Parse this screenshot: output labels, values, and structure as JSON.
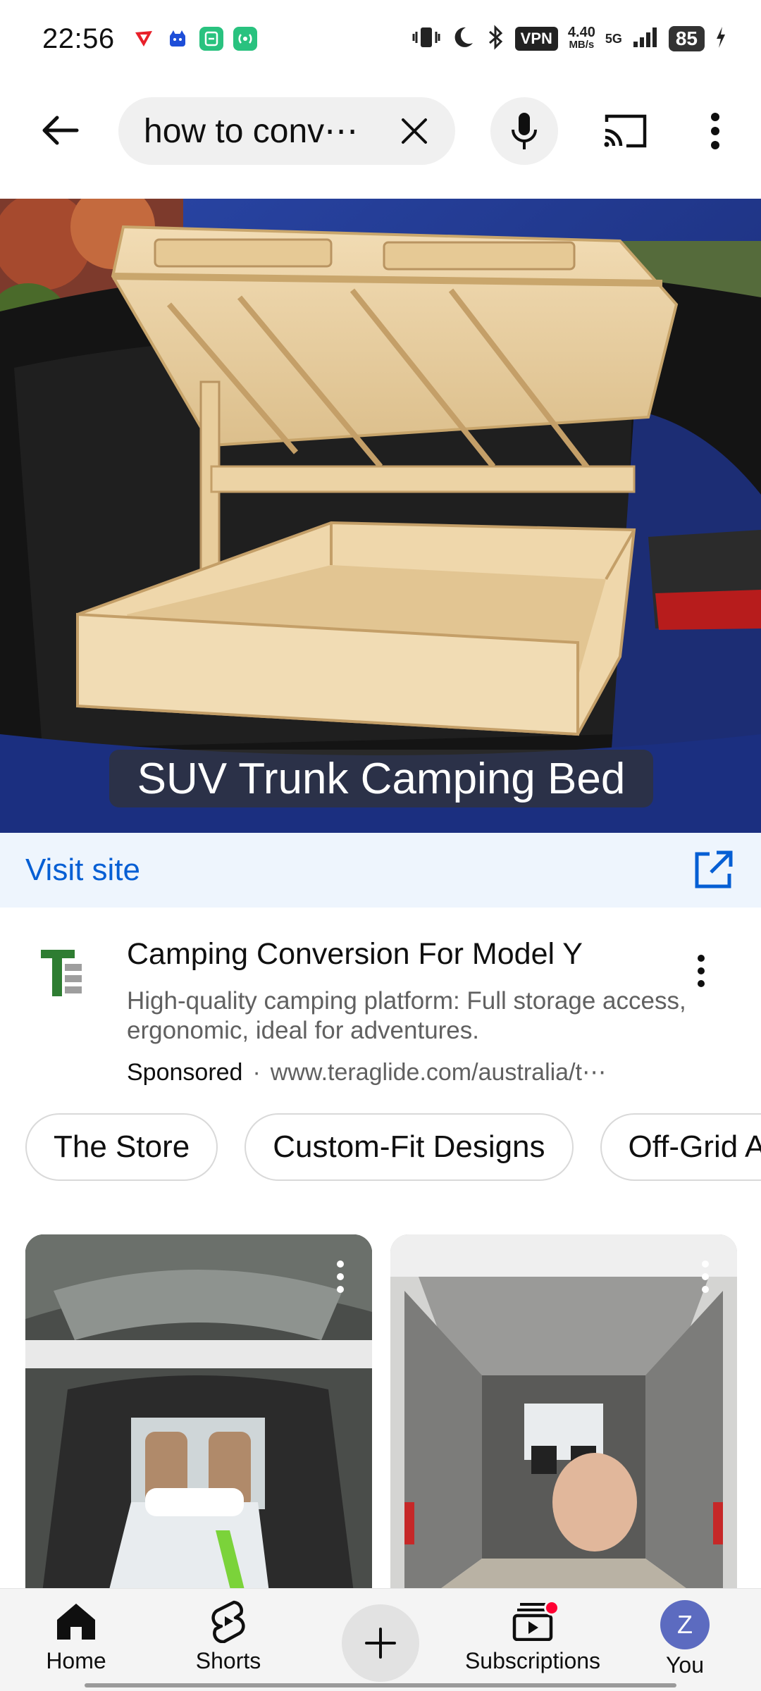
{
  "status_bar": {
    "time": "22:56",
    "vpn": "VPN",
    "speed_value": "4.40",
    "speed_unit": "MB/s",
    "network": "5G",
    "battery": "85"
  },
  "search": {
    "query": "how to conv⋯",
    "back_icon": "arrow-left-icon",
    "clear_icon": "close-icon",
    "mic_icon": "microphone-icon",
    "cast_icon": "cast-icon",
    "more_icon": "more-vertical-icon"
  },
  "ad": {
    "hero_caption": "SUV Trunk Camping Bed",
    "visit_label": "Visit site",
    "title": "Camping Conversion For Model Y",
    "description": "High-quality camping platform: Full storage access, ergonomic, ideal for adventures.",
    "sponsored": "Sponsored",
    "separator": "·",
    "url": "www.teraglide.com/australia/t⋯"
  },
  "chips": [
    "The Store",
    "Custom-Fit Designs",
    "Off-Grid A"
  ],
  "nav": {
    "home": "Home",
    "shorts": "Shorts",
    "subscriptions": "Subscriptions",
    "you": "You",
    "avatar_letter": "Z"
  },
  "colors": {
    "link_blue": "#065fd4",
    "visit_bg": "#eef5fd",
    "notification_red": "#ff0033",
    "avatar": "#5c6bc0"
  }
}
